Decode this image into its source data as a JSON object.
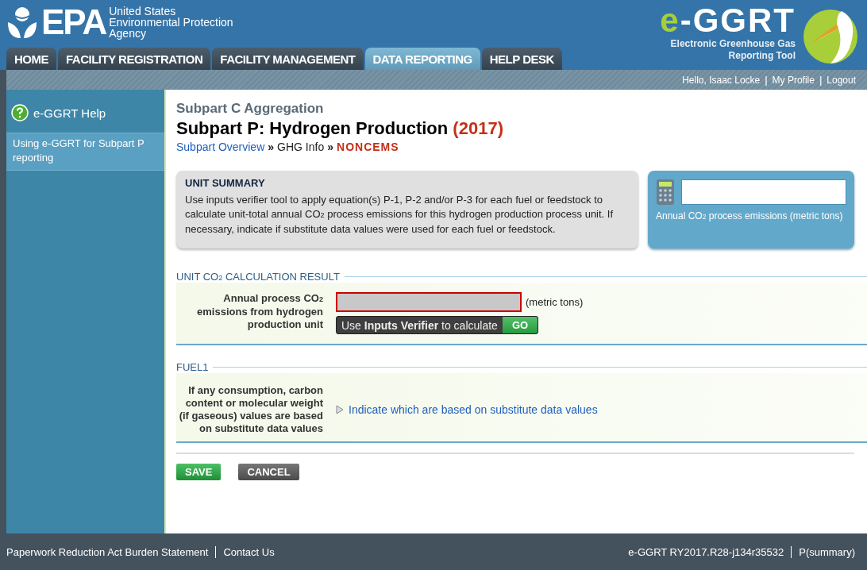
{
  "header": {
    "agency_lines": [
      "United States",
      "Environmental Protection",
      "Agency"
    ],
    "agency_mark": "EPA",
    "app_mark_prefix": "e",
    "app_mark_rest": "-GGRT",
    "app_subtitle_lines": [
      "Electronic Greenhouse Gas",
      "Reporting Tool"
    ]
  },
  "tabs": [
    {
      "label": "HOME",
      "selected": false
    },
    {
      "label": "FACILITY REGISTRATION",
      "selected": false
    },
    {
      "label": "FACILITY MANAGEMENT",
      "selected": false
    },
    {
      "label": "DATA REPORTING",
      "selected": true
    },
    {
      "label": "HELP DESK",
      "selected": false
    }
  ],
  "user_bar": {
    "items": [
      {
        "kind": "text",
        "label": "Hello, Isaac Locke"
      },
      {
        "kind": "sep",
        "label": "|"
      },
      {
        "kind": "link",
        "label": "My Profile"
      },
      {
        "kind": "sep",
        "label": "|"
      },
      {
        "kind": "link",
        "label": "Logout"
      }
    ]
  },
  "sidebar": {
    "help_title": "e-GGRT Help",
    "items": [
      {
        "label": "Using e-GGRT for Subpart P reporting",
        "selected": true
      }
    ]
  },
  "page": {
    "supertitle": "Subpart C Aggregation",
    "title": "Subpart P: Hydrogen Production",
    "year": "(2017)",
    "breadcrumb": [
      {
        "kind": "link",
        "label": "Subpart Overview"
      },
      {
        "kind": "sep",
        "label": "»"
      },
      {
        "kind": "plain",
        "label": "GHG Info"
      },
      {
        "kind": "sep",
        "label": "»"
      },
      {
        "kind": "current",
        "label": "NONCEMS"
      }
    ]
  },
  "unit_summary": {
    "heading": "UNIT SUMMARY",
    "text": "Use inputs verifier tool to apply equation(s) P-1, P-2 and/or P-3 for each fuel or feedstock to calculate unit-total annual CO$_{2}$ process emissions for this hydrogen production process unit. If necessary, indicate if substitute data values were used for each fuel or feedstock."
  },
  "calculator": {
    "label": "Annual CO$_{2}$ process emissions (metric tons)"
  },
  "sections": [
    {
      "kind": "result",
      "heading": "UNIT CO$_{2}$ CALCULATION RESULT",
      "label": "Annual process CO$_{2}$ emissions from hydrogen production unit",
      "unit": "(metric tons)",
      "tip": "Use **Inputs Verifier** to calculate",
      "go": "GO"
    },
    {
      "kind": "fuel",
      "heading": "FUEL1",
      "label": "If any consumption, carbon content or molecular weight (if gaseous) values are based on substitute data values",
      "link": "Indicate which are based on substitute data values"
    }
  ],
  "buttons": [
    {
      "kind": "save",
      "label": "SAVE"
    },
    {
      "kind": "cancel",
      "label": "CANCEL"
    }
  ],
  "footer": {
    "left": [
      "Paperwork Reduction Act Burden Statement",
      "Contact Us"
    ],
    "right": [
      "e-GGRT RY2017.R28-j134r35532",
      "P(summary)"
    ]
  }
}
